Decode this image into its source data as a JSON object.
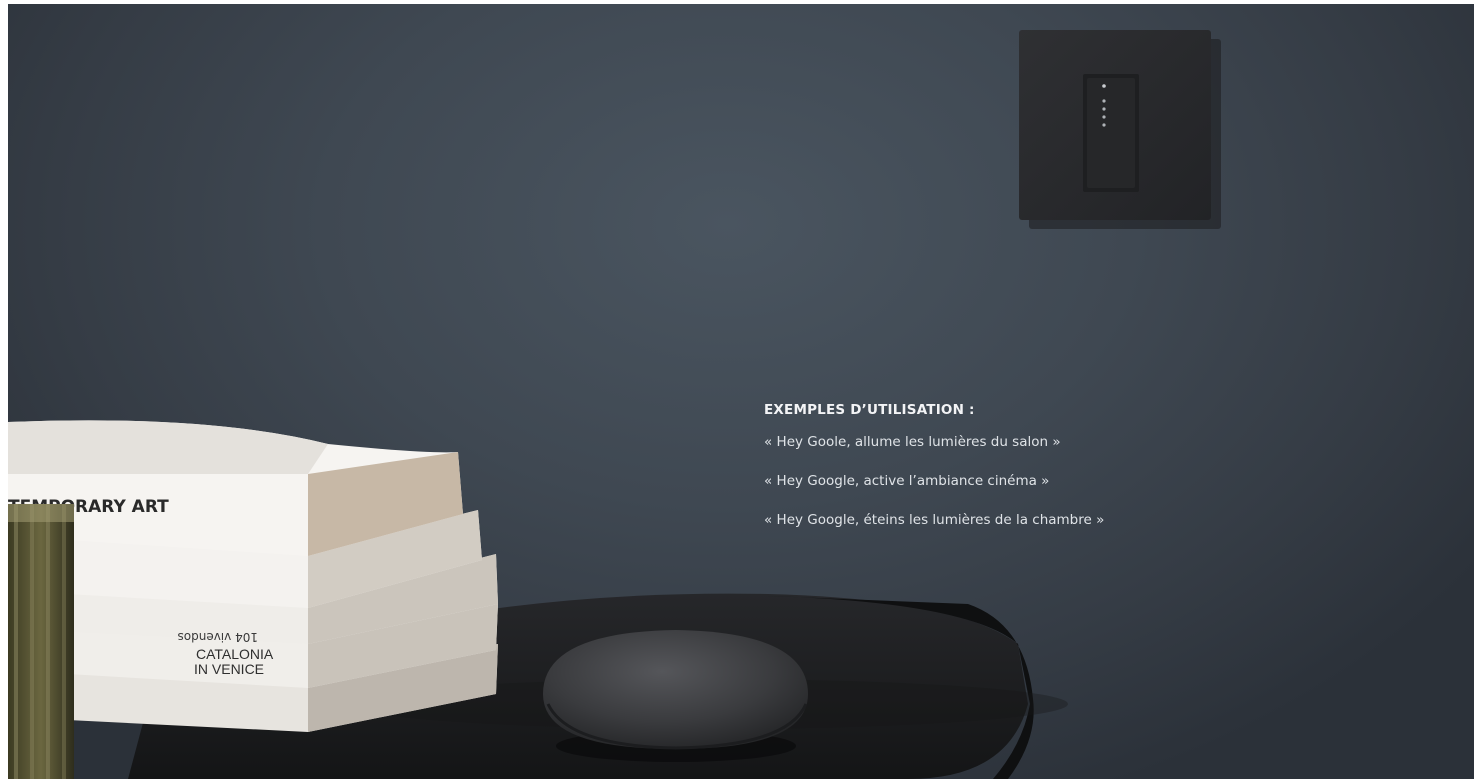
{
  "usage": {
    "heading": "EXEMPLES D’UTILISATION :",
    "examples": [
      "« Hey Goole, allume les lumières du salon »",
      "« Hey Google, active l’ambiance cinéma »",
      "« Hey Google, éteins les lumières de la chambre »"
    ]
  },
  "photo": {
    "book_titles": [
      "TEMPORARY ART",
      "104 vivendos",
      "CATALONIA",
      "IN VENICE"
    ],
    "wall_color": "#3f4852",
    "table_color": "#1d1e20",
    "speaker_color": "#3a3b3d",
    "switch_color": "#2a2b2d"
  }
}
